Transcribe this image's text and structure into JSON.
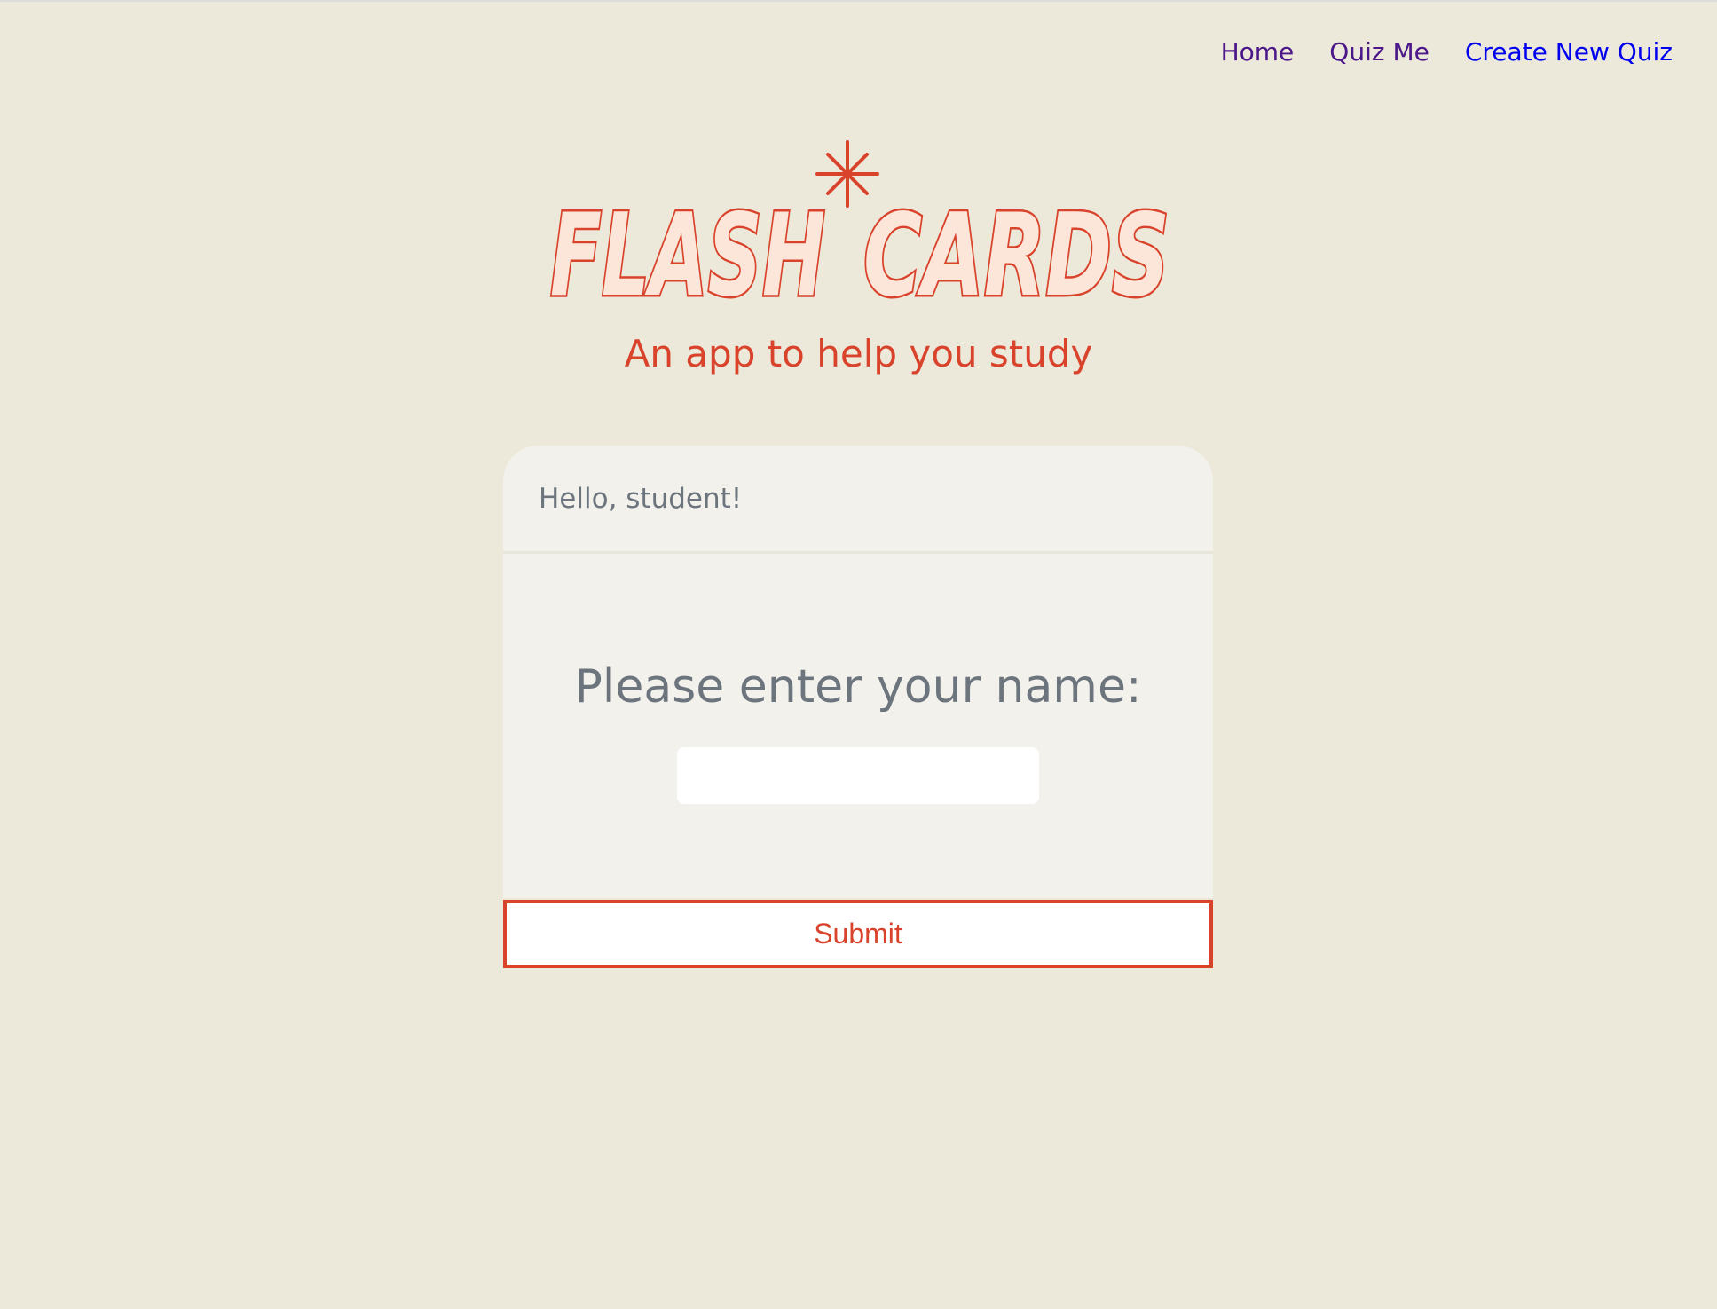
{
  "nav": {
    "home": "Home",
    "quiz_me": "Quiz Me",
    "create_new_quiz": "Create New Quiz"
  },
  "logo": {
    "text_left": "FLASH",
    "text_right": "CARDS",
    "icon": "sparkle-star-icon"
  },
  "tagline": "An app to help you study",
  "card": {
    "greeting": "Hello, student!",
    "prompt": "Please enter your name:",
    "name_input_value": "",
    "submit_label": "Submit"
  },
  "colors": {
    "background": "#ECE9DB",
    "card": "#F3F1EB",
    "accent": "#D9432B",
    "muted_text": "#6C757D",
    "link_visited": "#4B1788",
    "link": "#0000EE"
  }
}
